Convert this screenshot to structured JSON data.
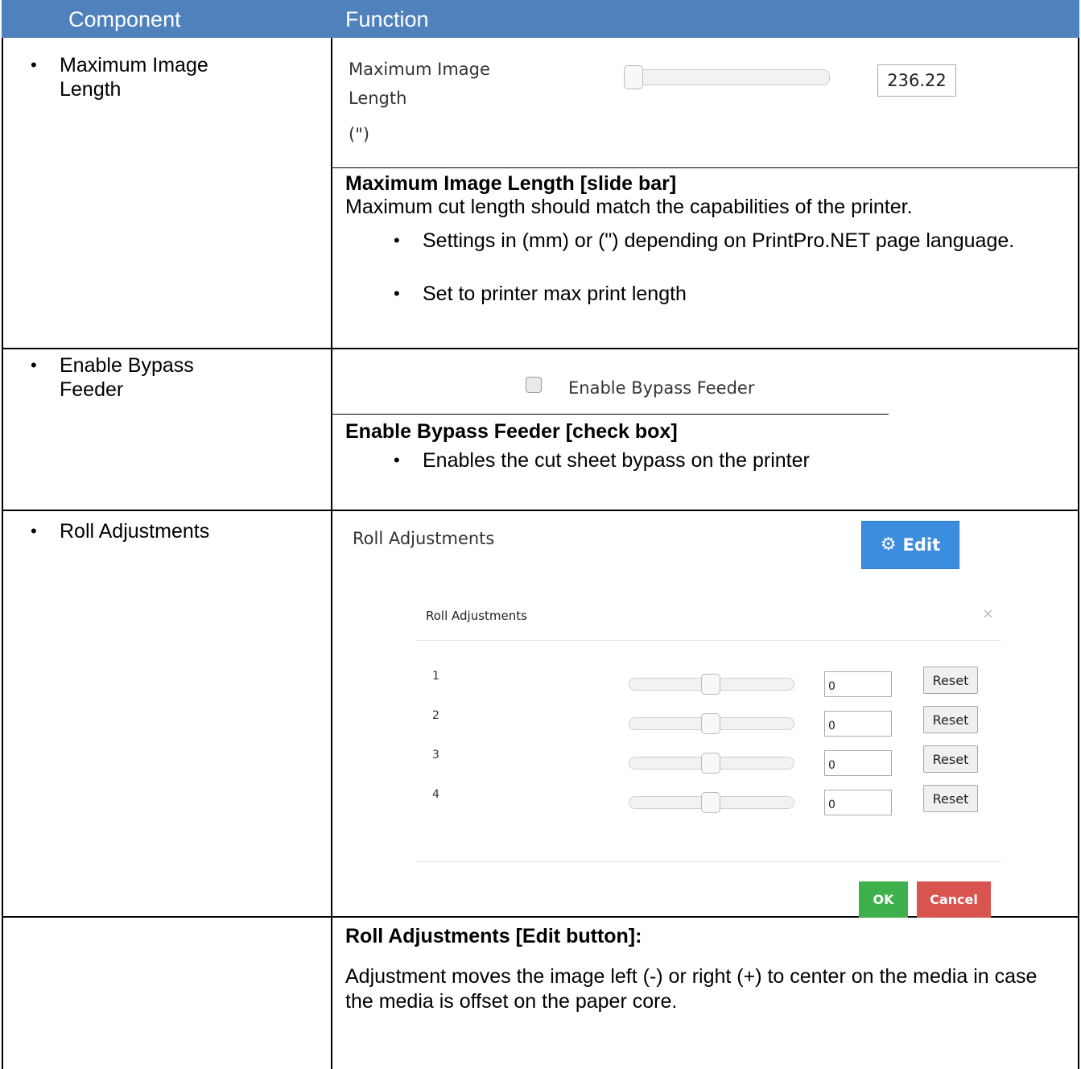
{
  "header": {
    "col1": "Component",
    "col2": "Function",
    "bg_color": "#4f81bd"
  },
  "max_image_length": {
    "component_label": "Maximum Image Length",
    "ui_label": "Maximum Image Length",
    "ui_unit": "(\")",
    "slider_level_fraction": 0,
    "value": "236.22",
    "desc_title": "Maximum Image Length [slide bar]",
    "desc_text": "Maximum cut length should match the capabilities of the printer.",
    "bullets": [
      "Settings in (mm) or (\") depending on PrintPro.NET page language.",
      "Set to printer max print length"
    ]
  },
  "bypass": {
    "component_label": "Enable Bypass Feeder",
    "checkbox_label": "Enable Bypass Feeder",
    "checked": false,
    "desc_title": "Enable Bypass Feeder [check box]",
    "bullets": [
      "Enables the cut sheet bypass on the printer"
    ]
  },
  "roll": {
    "component_label": "Roll Adjustments",
    "ui_label": "Roll Adjustments",
    "edit_label": "Edit",
    "edit_icon": "gear-icon",
    "edit_color": "#3c8dde",
    "dialog": {
      "title": "Roll Adjustments",
      "close": "×",
      "rows": [
        {
          "label": "1",
          "value": "0",
          "slider_level_fraction": 0.5,
          "reset": "Reset"
        },
        {
          "label": "2",
          "value": "0",
          "slider_level_fraction": 0.5,
          "reset": "Reset"
        },
        {
          "label": "3",
          "value": "0",
          "slider_level_fraction": 0.5,
          "reset": "Reset"
        },
        {
          "label": "4",
          "value": "0",
          "slider_level_fraction": 0.5,
          "reset": "Reset"
        }
      ],
      "ok": "OK",
      "cancel": "Cancel",
      "ok_color": "#3eb14d",
      "cancel_color": "#d9534f"
    },
    "desc_title": "Roll Adjustments [Edit button]:",
    "desc_text": "Adjustment moves the image left (-) or right (+) to center on the media in case the media is offset on the paper core."
  }
}
